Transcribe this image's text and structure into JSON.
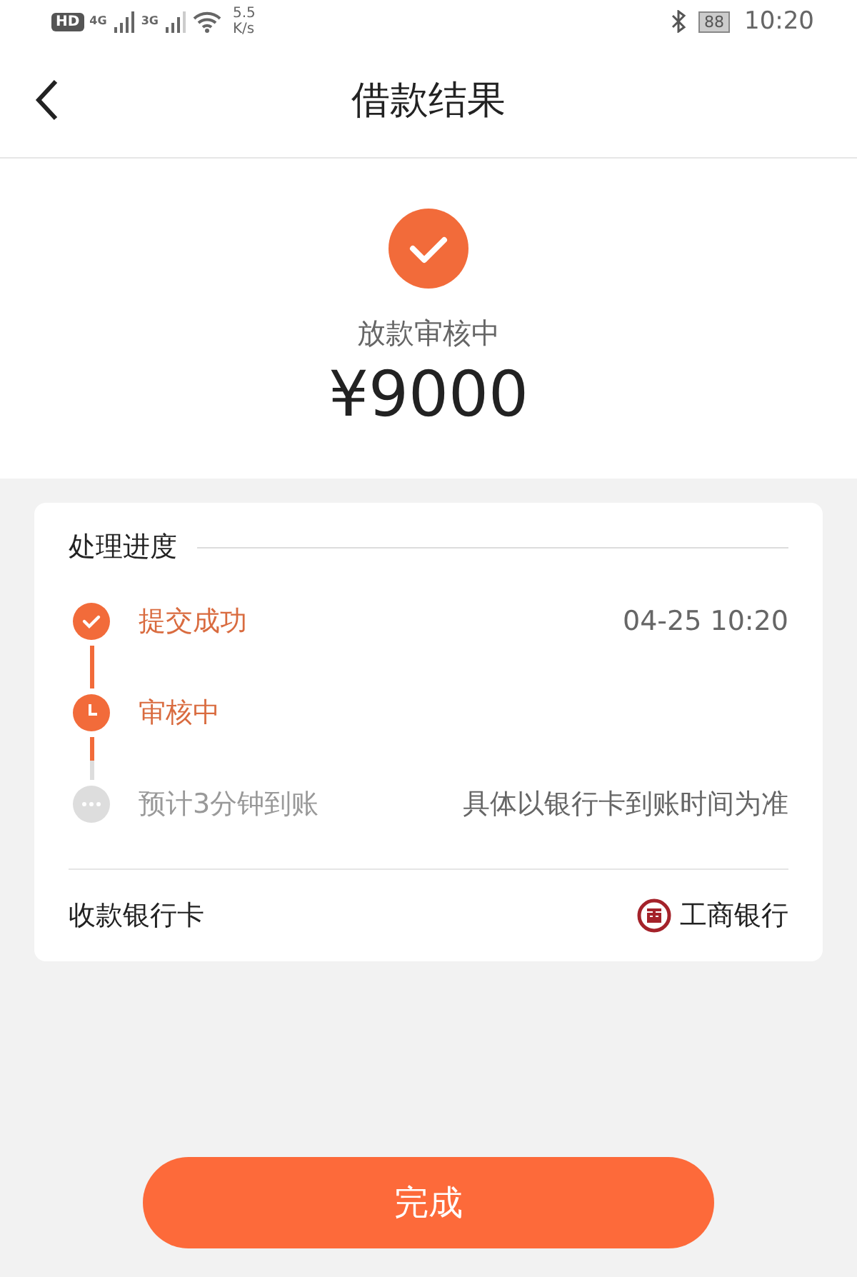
{
  "status_bar": {
    "hd": "HD",
    "net1": "4G",
    "net2": "3G",
    "speed": "5.5",
    "speed_unit": "K/s",
    "battery": "88",
    "time": "10:20"
  },
  "nav": {
    "title": "借款结果"
  },
  "result": {
    "status": "放款审核中",
    "amount": "¥9000"
  },
  "progress": {
    "title": "处理进度",
    "steps": [
      {
        "kind": "done",
        "label": "提交成功",
        "note": "04-25 10:20"
      },
      {
        "kind": "current",
        "label": "审核中"
      },
      {
        "kind": "pending",
        "label": "预计3分钟到账",
        "note": "具体以银行卡到账时间为准"
      }
    ]
  },
  "bank": {
    "label": "收款银行卡",
    "name": "工商银行"
  },
  "button": "完成"
}
